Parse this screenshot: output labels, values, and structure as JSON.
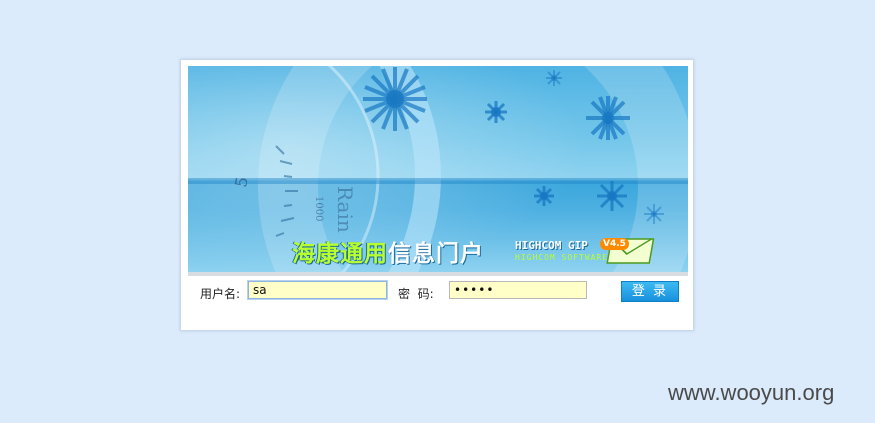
{
  "banner": {
    "title_green": "海康通用",
    "title_white": "信息门户",
    "brand": "HIGHCOM  GIP",
    "brand_sub": "HIGHCOM SOFTWARE",
    "version": "V4.5",
    "dial_numbers": [
      "5",
      "1000",
      "Rain"
    ]
  },
  "form": {
    "username_label": "用户名:",
    "username_value": "sa",
    "password_label": "密  码:",
    "password_value": "•••••",
    "login_button": "登 录"
  },
  "watermark": "www.wooyun.org",
  "colors": {
    "background": "#dcebfb",
    "field_bg": "#ffffc7",
    "button_top": "#3db9f2",
    "button_bottom": "#1891dd",
    "title_green": "#b7ff2e"
  }
}
